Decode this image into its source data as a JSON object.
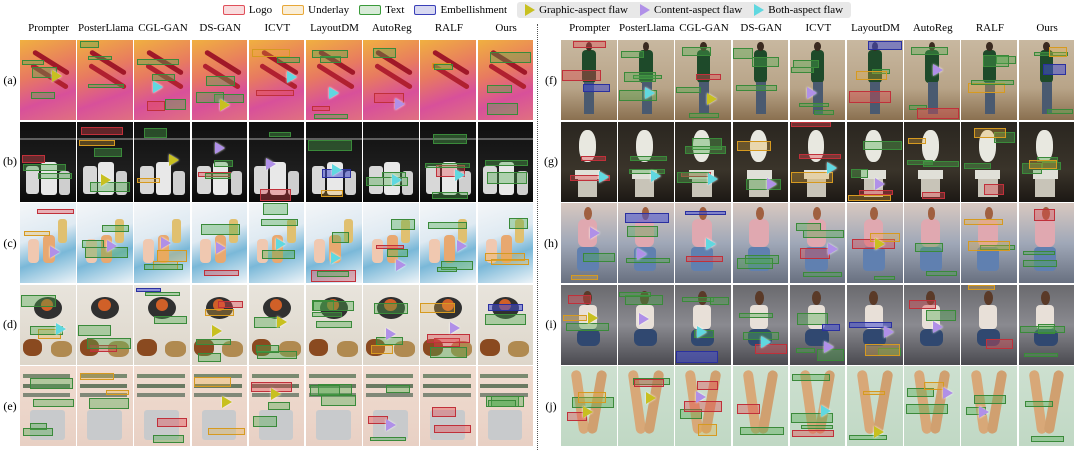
{
  "legend": {
    "items": [
      {
        "label": "Logo",
        "color": "#e0505a"
      },
      {
        "label": "Underlay",
        "color": "#e8a838"
      },
      {
        "label": "Text",
        "color": "#3a9a3a"
      },
      {
        "label": "Embellishment",
        "color": "#3a40b8"
      }
    ],
    "flaws": [
      {
        "label": "Graphic-aspect flaw",
        "color": "#c8c020"
      },
      {
        "label": "Content-aspect flaw",
        "color": "#b090e8"
      },
      {
        "label": "Both-aspect flaw",
        "color": "#60d8e0"
      }
    ]
  },
  "methods": [
    "Prompter",
    "PosterLlama",
    "CGL-GAN",
    "DS-GAN",
    "ICVT",
    "LayoutDM",
    "AutoReg",
    "RALF",
    "Ours"
  ],
  "left_rows": [
    {
      "label": "(a)",
      "bg": "linear-gradient(160deg,#f0b040 0%,#e87a60 40%,#d8509a 70%,#e07080 100%)",
      "obj": "ski"
    },
    {
      "label": "(b)",
      "bg": "linear-gradient(180deg,#101010 0%,#1e1e1e 60%,#0a0a0a 100%)",
      "obj": "luggage"
    },
    {
      "label": "(c)",
      "bg": "linear-gradient(160deg,#f4f6f8 0%,#dfeaf2 40%,#7ab8d8 65%,#eef4f8 100%)",
      "obj": "perfume"
    },
    {
      "label": "(d)",
      "bg": "linear-gradient(180deg,#e8e4dc 0%,#ddd6ca 100%)",
      "obj": "food"
    },
    {
      "label": "(e)",
      "bg": "linear-gradient(180deg,#f0dcd0 0%,#e8d0c4 100%)",
      "obj": "pot"
    }
  ],
  "right_rows": [
    {
      "label": "(f)",
      "bg": "linear-gradient(180deg,#c8b8a0 0%,#b8a488 60%,#8a7050 100%)",
      "obj": "person"
    },
    {
      "label": "(g)",
      "bg": "linear-gradient(180deg,#2a2620 0%,#3a342a 60%,#1c1814 100%)",
      "obj": "mirror"
    },
    {
      "label": "(h)",
      "bg": "linear-gradient(180deg,#d8c8c0 0%,#a0a8b8 50%,#687080 100%)",
      "obj": "girl"
    },
    {
      "label": "(i)",
      "bg": "linear-gradient(180deg,#6a6a6e 0%,#8a8a90 50%,#4a4a50 100%)",
      "obj": "woman"
    },
    {
      "label": "(j)",
      "bg": "linear-gradient(180deg,#cde0d0 0%,#c0d8c4 100%)",
      "obj": "legs"
    }
  ]
}
